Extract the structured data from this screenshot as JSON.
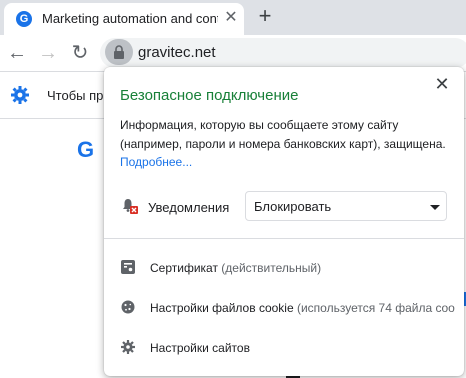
{
  "tab": {
    "title": "Marketing automation and conte",
    "favicon_letter": "G"
  },
  "toolbar": {
    "url": "gravitec.net"
  },
  "infobar": {
    "text": "Чтобы пр"
  },
  "site": {
    "logo_letter": "G"
  },
  "popup": {
    "title": "Безопасное подключение",
    "description": "Информация, которую вы сообщаете этому сайту (например, пароли и номера банковских карт), защищена.",
    "more_link": "Подробнее...",
    "permission_label": "Уведомления",
    "permission_value": "Блокировать",
    "certificate_label": "Сертификат",
    "certificate_status": "(действительный)",
    "cookies_label": "Настройки файлов cookie",
    "cookies_status": "(используется 74 файла coo",
    "site_settings_label": "Настройки сайтов"
  },
  "colors": {
    "secure_green": "#188038",
    "link_blue": "#1a73e8"
  }
}
